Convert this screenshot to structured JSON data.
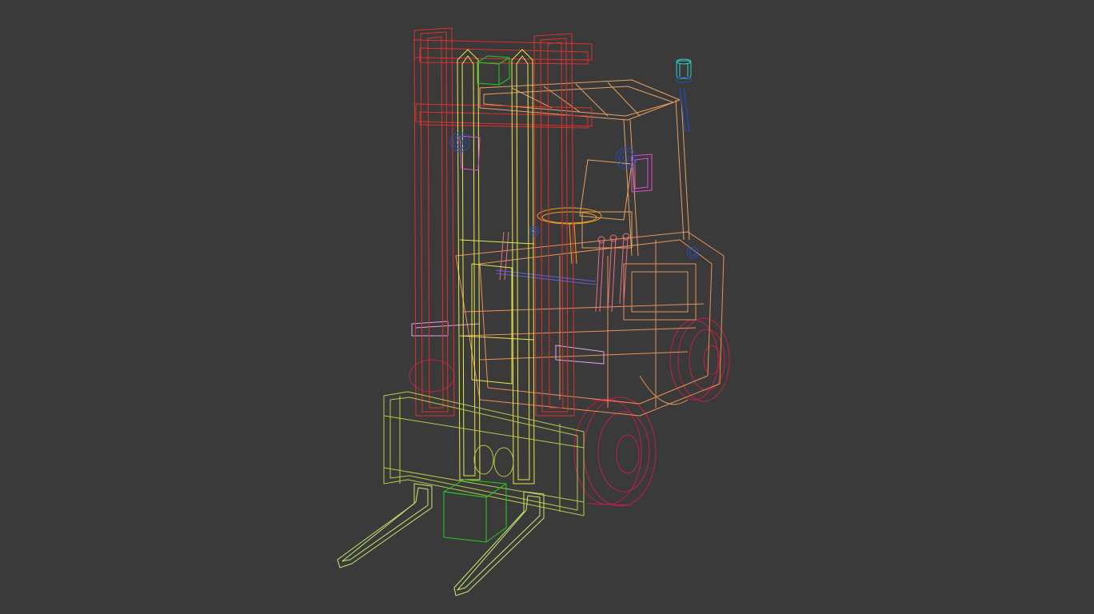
{
  "viewport": {
    "background": "#3a3a3a",
    "display_mode": "wireframe"
  },
  "scene": {
    "object": "forklift",
    "parts": [
      {
        "name": "outer-mast",
        "color": "#e0302e"
      },
      {
        "name": "inner-mast",
        "color": "#e8e84a"
      },
      {
        "name": "overhead-guard",
        "color": "#e8a060"
      },
      {
        "name": "cab-frame",
        "color": "#e8a060"
      },
      {
        "name": "body",
        "color": "#e8905a"
      },
      {
        "name": "rear-wheel",
        "color": "#c0204a"
      },
      {
        "name": "front-wheel",
        "color": "#c0204a"
      },
      {
        "name": "carriage",
        "color": "#b8c848"
      },
      {
        "name": "forks",
        "color": "#c8e870"
      },
      {
        "name": "load-box",
        "color": "#22cc22"
      },
      {
        "name": "top-box",
        "color": "#22cc22"
      },
      {
        "name": "steering-wheel",
        "color": "#f0a020"
      },
      {
        "name": "control-levers",
        "color": "#e87080"
      },
      {
        "name": "side-mirror",
        "color": "#e050d0"
      },
      {
        "name": "work-light",
        "color": "#2050c0"
      },
      {
        "name": "beacon-light",
        "color": "#30d0d0"
      },
      {
        "name": "hydraulic-cylinder",
        "color": "#e8a0e8"
      },
      {
        "name": "axle-rod",
        "color": "#6060e0"
      }
    ]
  }
}
